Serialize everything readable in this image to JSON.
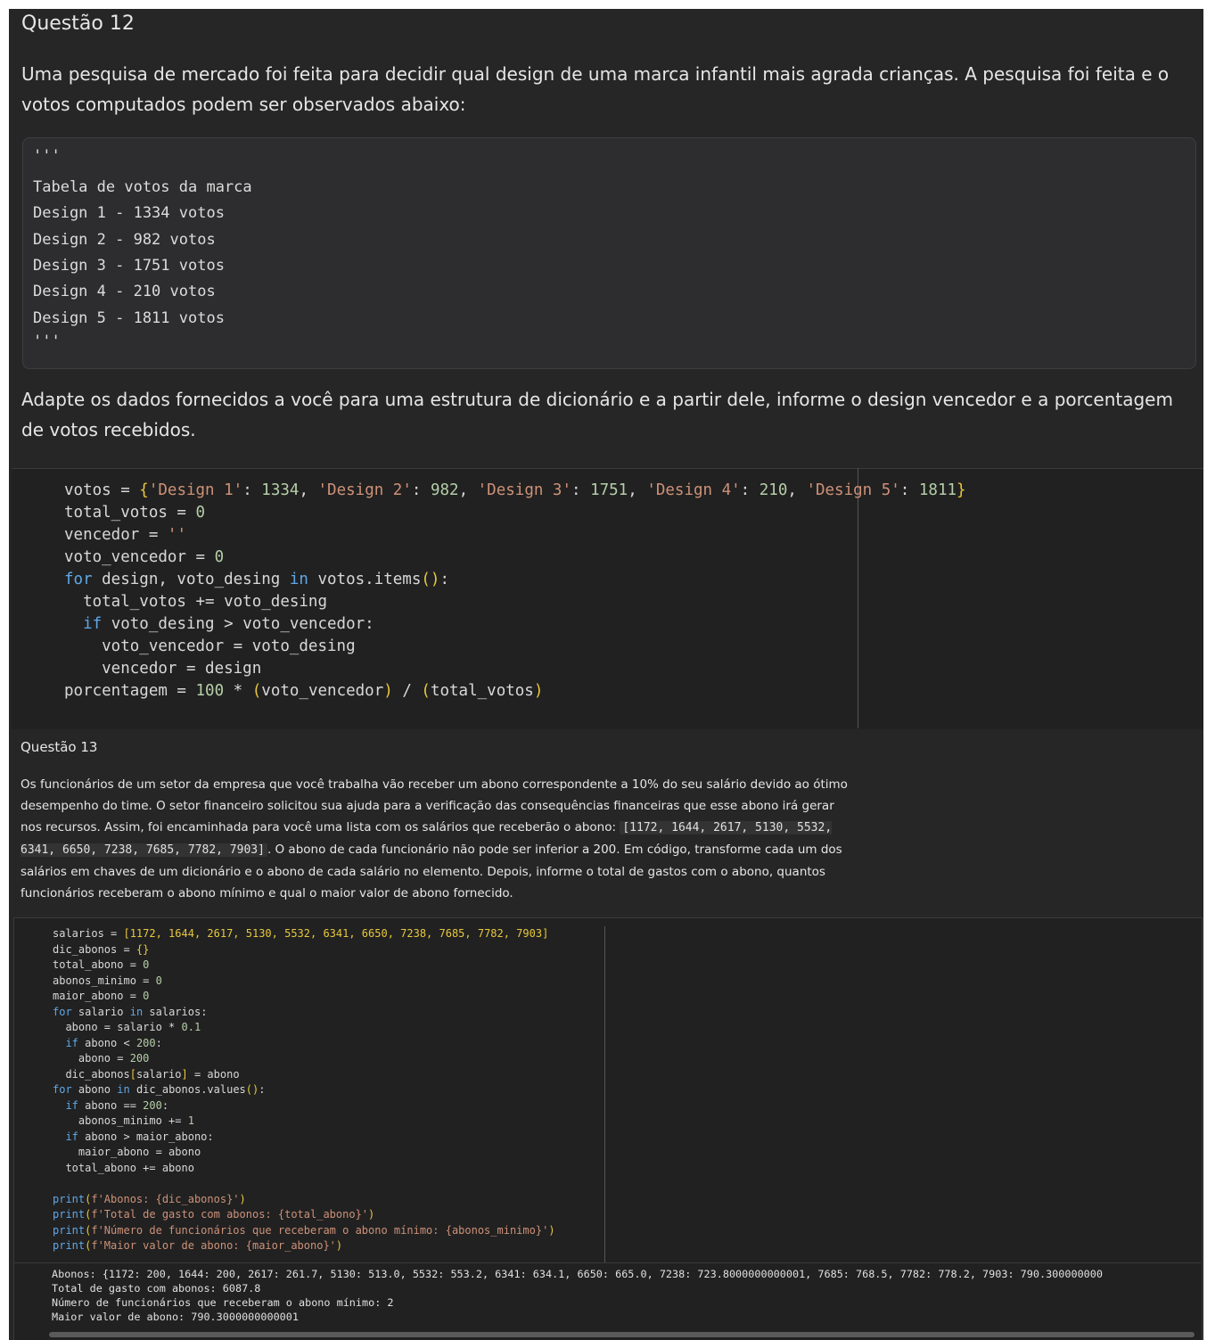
{
  "q12": {
    "title": "Questão 12",
    "paragraph": "Uma pesquisa de mercado foi feita para decidir qual design de uma marca infantil mais agrada crianças. A pesquisa foi feita e o votos computados podem ser observados abaixo:",
    "table_lines": [
      "'''",
      "Tabela de votos da marca",
      "Design 1 - 1334 votos",
      "Design 2 - 982 votos",
      "Design 3 - 1751 votos",
      "Design 4 - 210 votos",
      "Design 5 - 1811 votos",
      "'''"
    ],
    "question": "Adapte os dados fornecidos a você para uma estrutura de dicionário e a partir dele, informe o design vencedor e a porcentagem de votos recebidos.",
    "code": {
      "l1_a": "votos = ",
      "l1_b": "{",
      "l1_c": "'Design 1'",
      "l1_d": ": ",
      "l1_e": "1334",
      "l1_f": ", ",
      "l1_g": "'Design 2'",
      "l1_h": ": ",
      "l1_i": "982",
      "l1_j": ", ",
      "l1_k": "'Design 3'",
      "l1_l": ": ",
      "l1_m": "1751",
      "l1_n": ", ",
      "l1_o": "'Design 4'",
      "l1_p": ": ",
      "l1_q": "210",
      "l1_r": ", ",
      "l1_s": "'Design 5'",
      "l1_t": ": ",
      "l1_u": "1811",
      "l1_v": "}",
      "l2_a": "total_votos = ",
      "l2_b": "0",
      "l3_a": "vencedor = ",
      "l3_b": "''",
      "l4_a": "voto_vencedor = ",
      "l4_b": "0",
      "l5_a": "for",
      "l5_b": " design, voto_desing ",
      "l5_c": "in",
      "l5_d": " votos.items",
      "l5_e": "()",
      "l5_f": ":",
      "l6": "  total_votos += voto_desing",
      "l7_a": "  if",
      "l7_b": " voto_desing > voto_vencedor:",
      "l8": "    voto_vencedor = voto_desing",
      "l9": "    vencedor = design",
      "l10_a": "porcentagem = ",
      "l10_b": "100",
      "l10_c": " * ",
      "l10_d": "(",
      "l10_e": "voto_vencedor",
      "l10_f": ")",
      "l10_g": " / ",
      "l10_h": "(",
      "l10_i": "total_votos",
      "l10_j": ")"
    }
  },
  "q13": {
    "title": "Questão 13",
    "para_part1": "Os funcionários de um setor da empresa que você trabalha vão receber um abono correspondente a 10% do seu salário devido ao ótimo desempenho do time. O setor financeiro solicitou sua ajuda para a verificação das consequências financeiras que esse abono irá gerar nos recursos. Assim, foi encaminhada para você uma lista com os salários que receberão o abono: ",
    "inline_code": "[1172, 1644, 2617, 5130, 5532, 6341, 6650, 7238, 7685, 7782, 7903]",
    "para_part2": ". O abono de cada funcionário não pode ser inferior a 200. Em código, transforme cada um dos salários em chaves de um dicionário e o abono de cada salário no elemento. Depois, informe o total de gastos com o abono, quantos funcionários receberam o abono mínimo e qual o maior valor de abono fornecido.",
    "code": {
      "c1_a": "salarios = ",
      "c1_b": "[1172, 1644, 2617, 5130, 5532, 6341, 6650, 7238, 7685, 7782, 7903]",
      "c2_a": "dic_abonos = ",
      "c2_b": "{}",
      "c3_a": "total_abono = ",
      "c3_b": "0",
      "c4_a": "abonos_minimo = ",
      "c4_b": "0",
      "c5_a": "maior_abono = ",
      "c5_b": "0",
      "c6_a": "for",
      "c6_b": " salario ",
      "c6_c": "in",
      "c6_d": " salarios:",
      "c7_a": "  abono = salario * ",
      "c7_b": "0.1",
      "c8_a": "  if",
      "c8_b": " abono < ",
      "c8_c": "200",
      "c8_d": ":",
      "c9_a": "    abono = ",
      "c9_b": "200",
      "c10_a": "  dic_abonos",
      "c10_b": "[",
      "c10_c": "salario",
      "c10_d": "]",
      "c10_e": " = abono",
      "c11_a": "for",
      "c11_b": " abono ",
      "c11_c": "in",
      "c11_d": " dic_abonos.values",
      "c11_e": "()",
      "c11_f": ":",
      "c12_a": "  if",
      "c12_b": " abono == ",
      "c12_c": "200",
      "c12_d": ":",
      "c13_a": "    abonos_minimo += ",
      "c13_b": "1",
      "c14_a": "  if",
      "c14_b": " abono > maior_abono:",
      "c15": "    maior_abono = abono",
      "c16": "  total_abono += abono",
      "c17_a": "print",
      "c17_b": "(",
      "c17_c": "f'Abonos: {dic_abonos}'",
      "c17_d": ")",
      "c18_a": "print",
      "c18_b": "(",
      "c18_c": "f'Total de gasto com abonos: {total_abono}'",
      "c18_d": ")",
      "c19_a": "print",
      "c19_b": "(",
      "c19_c": "f'Número de funcionários que receberam o abono mínimo: {abonos_minimo}'",
      "c19_d": ")",
      "c20_a": "print",
      "c20_b": "(",
      "c20_c": "f'Maior valor de abono: {maior_abono}'",
      "c20_d": ")"
    },
    "output_lines": [
      "Abonos: {1172: 200, 1644: 200, 2617: 261.7, 5130: 513.0, 5532: 553.2, 6341: 634.1, 6650: 665.0, 7238: 723.8000000000001, 7685: 768.5, 7782: 778.2, 7903: 790.300000000",
      "Total de gasto com abonos: 6087.8",
      "Número de funcionários que receberam o abono mínimo: 2",
      "Maior valor de abono: 790.3000000000001"
    ]
  }
}
